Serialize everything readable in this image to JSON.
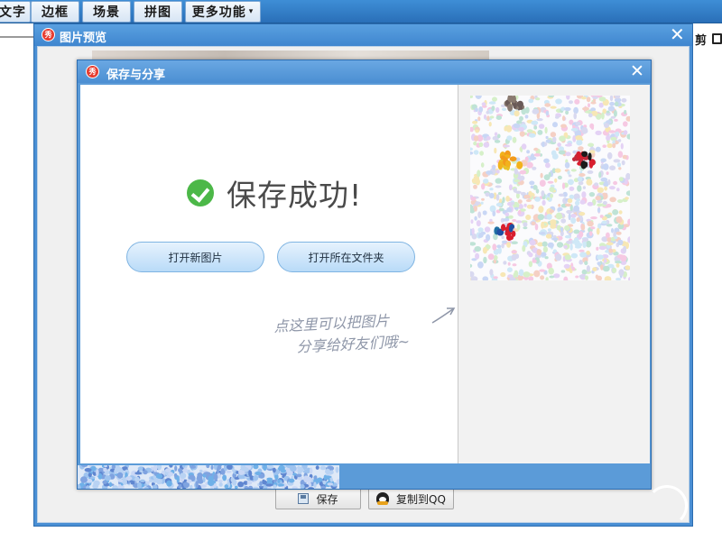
{
  "menubar": {
    "items": [
      {
        "label": "文字",
        "caret": false
      },
      {
        "label": "边框",
        "caret": false
      },
      {
        "label": "场景",
        "caret": false
      },
      {
        "label": "拼图",
        "caret": false
      },
      {
        "label": "更多功能",
        "caret": true
      }
    ],
    "caret_glyph": "▾"
  },
  "app_side": {
    "crop_label": "剪",
    "icon": "crop-icon"
  },
  "preview_window": {
    "title": "图片预览",
    "close_glyph": "✕",
    "save_label": "保存",
    "copy_qq_label": "复制到QQ",
    "logo_glyph": "秀"
  },
  "dialog": {
    "title": "保存与分享",
    "close_glyph": "✕",
    "logo_glyph": "秀",
    "success_text": "保存成功!",
    "open_new_label": "打开新图片",
    "open_folder_label": "打开所在文件夹",
    "hint_line1": "点这里可以把图片",
    "hint_line2": "分享给好友们哦~"
  },
  "colors": {
    "title_bar": "#4a8fd4",
    "success_green": "#4cb848",
    "pill_button": "#b9dbf8",
    "logo_red": "#e63a2e"
  }
}
